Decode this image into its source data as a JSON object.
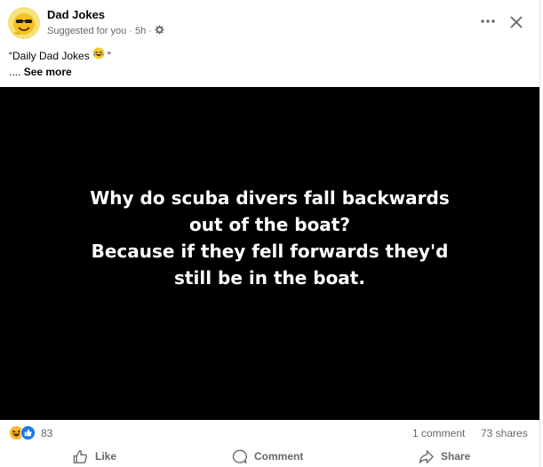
{
  "post": {
    "page_name": "Dad Jokes",
    "suggested": "Suggested for you",
    "dot1": "·",
    "time": "5h",
    "dot2": "·",
    "icons": {
      "more": "more-dots-icon",
      "close": "close-icon",
      "audience": "settings-gear-icon"
    },
    "caption": {
      "open_quote": "“Daily Dad Jokes",
      "emoji": "laughing-face-emoji",
      "close_quote": "”",
      "see_more_prefix": "....",
      "see_more": "See more"
    },
    "image_text": {
      "line1": "Why do scuba divers fall backwards",
      "line2": "out of the boat?",
      "line3": "Because if they fell forwards they'd",
      "line4": "still be in the boat."
    }
  },
  "stats": {
    "reaction_icons": [
      "laugh-reaction-icon",
      "like-reaction-icon"
    ],
    "reaction_count": "83",
    "comments": "1 comment",
    "shares": "73 shares"
  },
  "actions": {
    "like": "Like",
    "comment": "Comment",
    "share": "Share"
  },
  "colors": {
    "secondary_text": "#65676b",
    "like_blue": "#1877f2",
    "laugh_yellow": "#f7b928",
    "media_bg": "#000000"
  }
}
